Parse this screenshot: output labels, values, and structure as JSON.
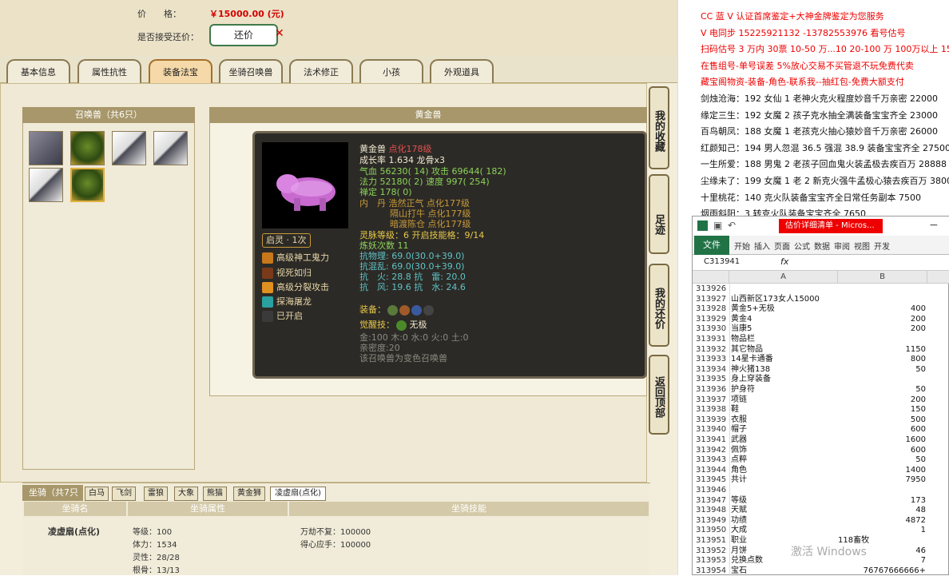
{
  "game": {
    "price_label": "价　　格：",
    "price_value": "￥15000.00 (元)",
    "accept_label": "是否接受还价：",
    "accept_btn": "还价",
    "tabs": [
      "基本信息",
      "属性抗性",
      "装备法宝",
      "坐骑召唤兽",
      "法术修正",
      "小孩",
      "外观道具"
    ],
    "active_tab": 2,
    "summon_header": "召唤兽（共6只）",
    "detail_header": "黄金兽",
    "pet": {
      "name": "黄金兽",
      "name_suffix": "点化178级",
      "growth": "成长率 1.634 龙骨x3",
      "hp": "气血 56230( 14) 攻击 69644( 182)",
      "mp": "法力 52180( 2) 速度 997( 254)",
      "mind": "禅定 178( 0)",
      "neidan1": "内　丹 浩然正气 点化177级",
      "neidan2": "隔山打牛 点化177级",
      "neidan3": "暗渡陈仓 点化177级",
      "lingyun": "灵脉等级：6 开启技能格：9/14",
      "lianyao": "炼妖次数 11",
      "kwuli": "抗物理: 69.0(30.0+39.0)",
      "khunluan": "抗混乱: 69.0(30.0+39.0)",
      "khuo": "抗　火: 28.8 抗　雷: 20.0",
      "kfeng": "抗　风: 19.6 抗　水: 24.6",
      "equip_label": "装备：",
      "juexing": "觉醒技：",
      "juexing_val": "无极",
      "wuxing": "金:100 木:0 水:0 火:0 土:0",
      "qinmi": "亲密度:20",
      "change": "该召唤兽为变色召唤兽",
      "qiling": "启灵 · 1次",
      "skills": [
        "高级神工鬼力",
        "视死如归",
        "高级分裂攻击",
        "探海屠龙",
        "已开启"
      ]
    },
    "side_buttons": [
      "我的收藏",
      "足迹",
      "我的还价",
      "返回顶部"
    ],
    "mounts": {
      "header": "坐骑（共7只",
      "tabs": [
        "白马",
        "飞剑",
        "雷狼",
        "大象",
        "熊猫",
        "黄金狮",
        "凌虚扇(点化)"
      ],
      "col1": "坐骑名",
      "col2": "坐骑属性",
      "col3": "坐骑技能",
      "name": "凌虚扇(点化)",
      "attrs": [
        "等级：100",
        "体力：1534",
        "灵性：28/28",
        "根骨：13/13"
      ],
      "skills": [
        "万劫不复：100000",
        "得心应手：100000"
      ]
    }
  },
  "right": {
    "lines": [
      {
        "t": "CC 蓝 V 认证首席鉴定+大神金牌鉴定为您服务",
        "c": "red"
      },
      {
        "t": "V 电同步 15225921132 -13782553976 看号估号",
        "c": "red"
      },
      {
        "t": "扫码估号 3 万内 30票 10-50 万...10 20-100 万 100万以上 150",
        "c": "red"
      },
      {
        "t": "在售组号-单号误差 5%放心交易不买管退不玩免费代卖",
        "c": "red"
      },
      {
        "t": "藏宝阁物资-装备-角色-联系我--抽红包-免费大额支付",
        "c": "red"
      },
      {
        "t": "剑烛沧海：192 女仙 1 老神火克火程度妙音千万亲密 22000",
        "c": "blk"
      },
      {
        "t": "缘定三生：192 女魔 2 孩子克水抽全满装备宝宝齐全 23000",
        "c": "blk"
      },
      {
        "t": "百鸟朝凤：188 女魔 1 老孩克火抽心猿妙音千万亲密 26000",
        "c": "blk"
      },
      {
        "t": "红颜知己：194 男人忽混 36.5 强混 38.9 装备宝宝齐全 27500",
        "c": "blk"
      },
      {
        "t": "一生所爱：188 男鬼 2 老孩子回血鬼火装孟极去疾百万 28888",
        "c": "blk"
      },
      {
        "t": "尘缘未了：199 女魔 1 老 2 新克火强牛孟极心猿去疾百万 3800",
        "c": "blk"
      },
      {
        "t": "十里桃花：140 克火队装备宝宝齐全日常任务副本 7500",
        "c": "blk"
      },
      {
        "t": "烟雨斜阳：3 转克火队装备宝宝齐全 7650",
        "c": "blk"
      }
    ],
    "excel": {
      "title": "估价详细清单 - Micros...",
      "file_btn": "文件",
      "ribbon_tabs": [
        "开始",
        "插入",
        "页面",
        "公式",
        "数据",
        "审阅",
        "视图",
        "开发"
      ],
      "cell_ref": "C313941",
      "fx": "fx",
      "col_a": "A",
      "col_b": "B",
      "rows": [
        [
          "313926",
          "",
          ""
        ],
        [
          "313927",
          "山西新区173女人15000",
          ""
        ],
        [
          "313928",
          "黄金5+无极",
          "400"
        ],
        [
          "313929",
          "黄金4",
          "200"
        ],
        [
          "313930",
          "当康5",
          "200"
        ],
        [
          "313931",
          "物品栏",
          ""
        ],
        [
          "313932",
          "其它物品",
          "1150"
        ],
        [
          "313933",
          "14星卡通番",
          "800"
        ],
        [
          "313934",
          "神火猪138",
          "50"
        ],
        [
          "313935",
          "身上穿装备",
          ""
        ],
        [
          "313936",
          "护身符",
          "50"
        ],
        [
          "313937",
          "项链",
          "200"
        ],
        [
          "313938",
          "鞋",
          "150"
        ],
        [
          "313939",
          "衣服",
          "500"
        ],
        [
          "313940",
          "帽子",
          "600"
        ],
        [
          "313941",
          "武器",
          "1600"
        ],
        [
          "313942",
          "佩饰",
          "600"
        ],
        [
          "313943",
          "点粹",
          "50"
        ],
        [
          "313944",
          "角色",
          "1400"
        ],
        [
          "313945",
          "共计",
          "7950"
        ],
        [
          "313946",
          "",
          ""
        ],
        [
          "313947",
          "等级",
          "173"
        ],
        [
          "313948",
          "天赋",
          "48"
        ],
        [
          "313949",
          "功绩",
          "4872"
        ],
        [
          "313950",
          "大成",
          "1"
        ],
        [
          "313951",
          "职业",
          "118畜牧"
        ],
        [
          "313952",
          "月饼",
          "46"
        ],
        [
          "313953",
          "兑换点数",
          "7"
        ],
        [
          "313954",
          "宝石",
          "76767666666+"
        ]
      ]
    },
    "watermark": "激活 Windows"
  }
}
